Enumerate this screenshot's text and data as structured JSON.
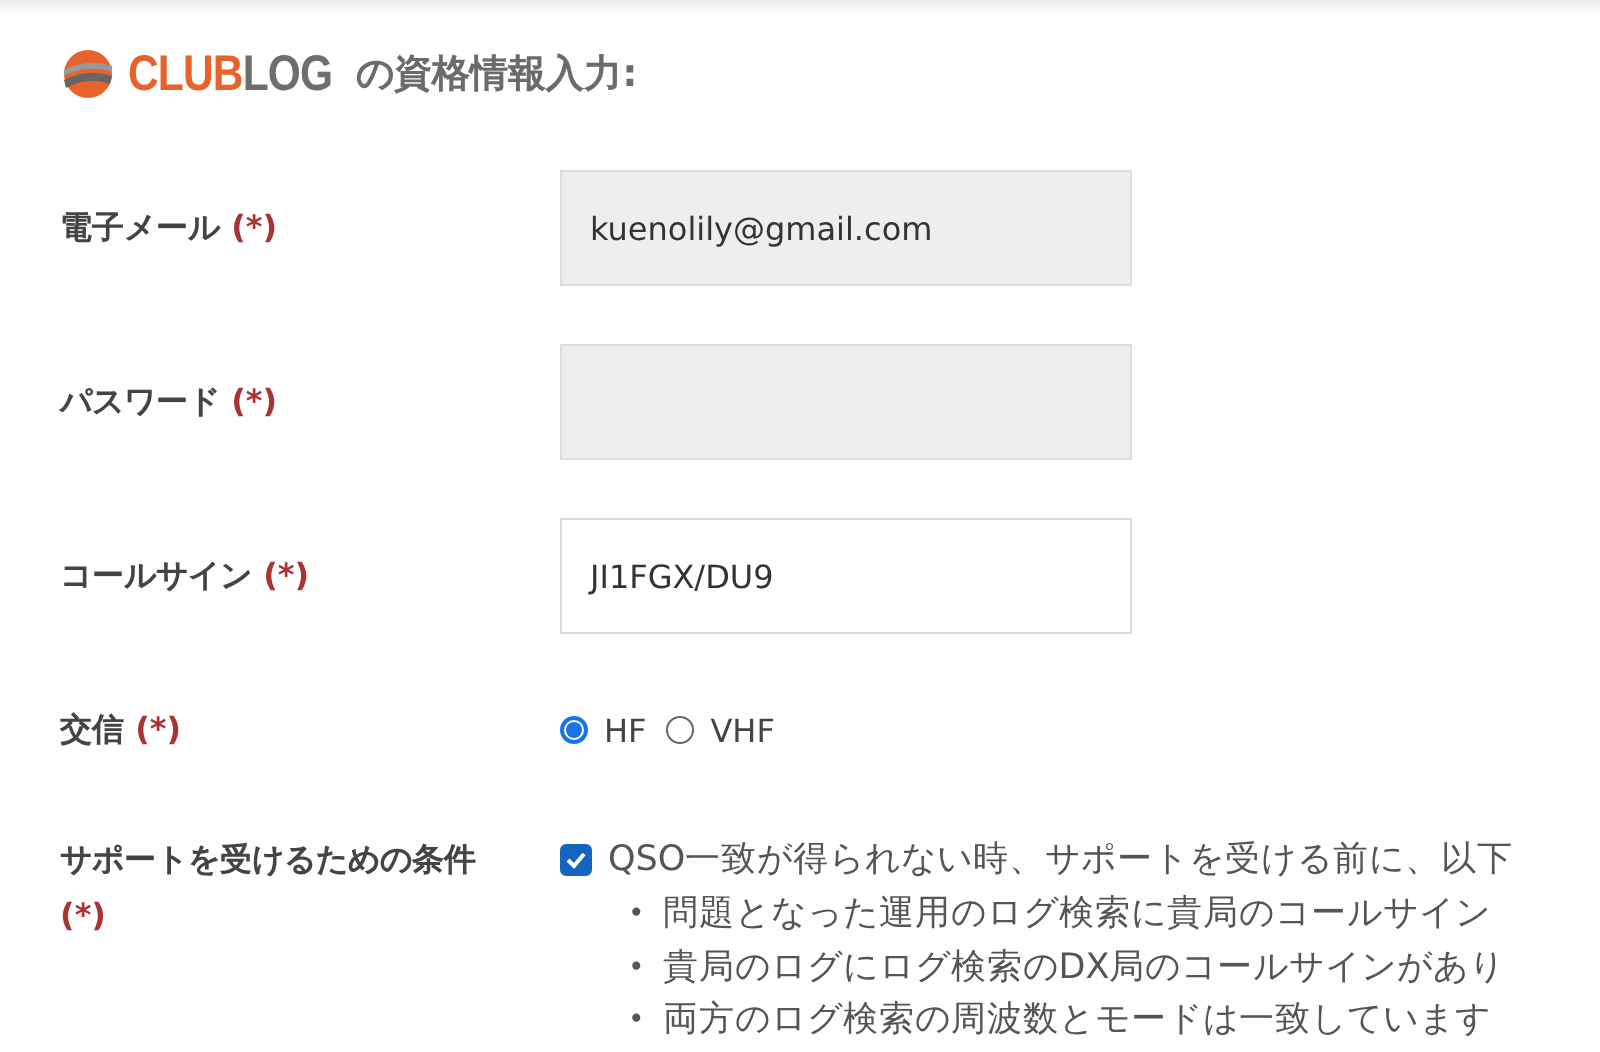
{
  "header": {
    "brand_part_1": "CLUB",
    "brand_part_2": "LOG",
    "title": "の資格情報入力:"
  },
  "fields": [
    {
      "kind": "input",
      "label": "電子メール",
      "required": "(*)",
      "value": "kuenolily@gmail.com",
      "disabled": true
    },
    {
      "kind": "input",
      "label": "パスワード",
      "required": "(*)",
      "disabled": true
    },
    {
      "kind": "input",
      "label": "コールサイン",
      "required": "(*)",
      "value": "JI1FGX/DU9",
      "disabled": false
    },
    {
      "kind": "radio",
      "label": "交信",
      "required": "(*)",
      "options": [
        {
          "label": "HF",
          "selected": true
        },
        {
          "label": "VHF",
          "selected": false
        }
      ]
    },
    {
      "kind": "checkbox",
      "label": "サポートを受けるための条件",
      "required": "(*)",
      "checked": true,
      "text": "QSO一致が得られない時、サポートを受ける前に、以下",
      "bullets": [
        {
          "marker": "•",
          "text": "問題となった運用のログ検索に貴局のコールサイン"
        },
        {
          "marker": "•",
          "text": "貴局のログにログ検索のDX局のコールサインがあり"
        },
        {
          "marker": "•",
          "text": "両方のログ検索の周波数とモードは一致しています"
        }
      ]
    }
  ]
}
